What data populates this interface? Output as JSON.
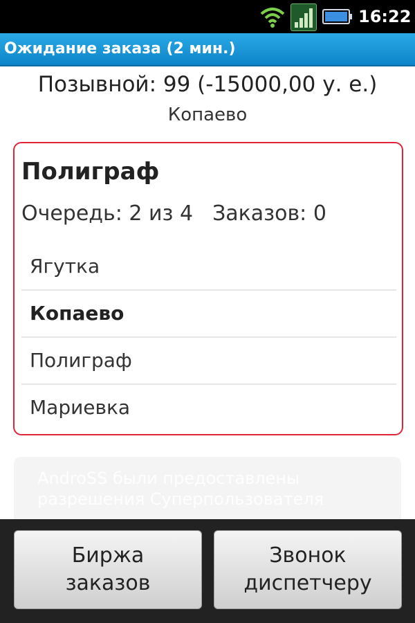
{
  "status_bar": {
    "time": "16:22",
    "icons": [
      "wifi-icon",
      "signal-icon",
      "battery-icon"
    ]
  },
  "title_bar": {
    "title": "Ожидание заказа (2 мин.)"
  },
  "header": {
    "callsign": "Позывной: 99 (-15000,00 у. е.)",
    "location": "Копаево"
  },
  "queue_card": {
    "title": "Полиграф",
    "queue_text": "Очередь: 2 из 4",
    "orders_text": "Заказов: 0",
    "points": [
      "Ягутка",
      "Копаево",
      "Полиграф",
      "Мариевка"
    ],
    "current_point": "Копаево"
  },
  "toast": {
    "text": "AndroSS были предоставлены разрешения Суперпользователя"
  },
  "buttons": {
    "exchange": "Биржа\nзаказов",
    "call_dispatcher": "Звонок\nдиспетчеру"
  },
  "colors": {
    "title_bar": "#1a96d8",
    "card_border": "#e0243a",
    "bottom_bar": "#222222"
  }
}
